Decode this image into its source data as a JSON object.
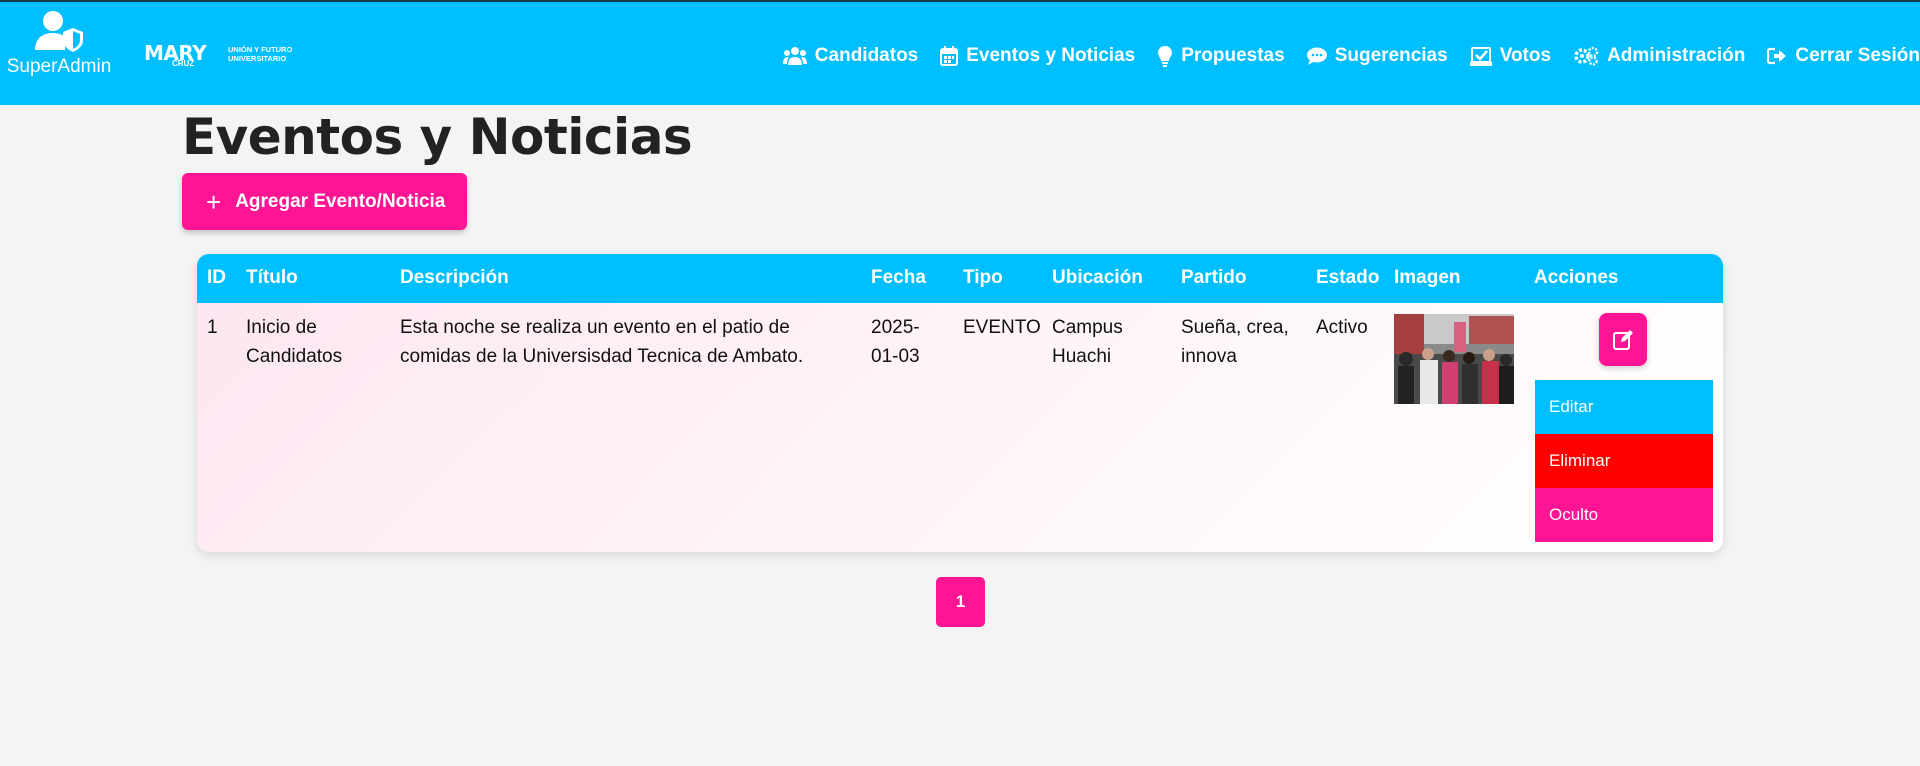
{
  "brand": {
    "label": "SuperAdmin"
  },
  "logo": {
    "name": "MARY",
    "sub": "CRUZ",
    "tagline": "UNIÓN Y FUTURO UNIVERSITARIO"
  },
  "nav": {
    "items": [
      {
        "label": "Candidatos",
        "icon": "users-icon"
      },
      {
        "label": "Eventos y Noticias",
        "icon": "calendar-icon"
      },
      {
        "label": "Propuestas",
        "icon": "lightbulb-icon"
      },
      {
        "label": "Sugerencias",
        "icon": "comment-icon"
      },
      {
        "label": "Votos",
        "icon": "vote-icon"
      },
      {
        "label": "Administración",
        "icon": "gears-icon"
      },
      {
        "label": "Cerrar Sesión",
        "icon": "logout-icon"
      }
    ]
  },
  "page": {
    "title": "Eventos y Noticias",
    "add_label": "Agregar Evento/Noticia"
  },
  "table": {
    "columns": [
      "ID",
      "Título",
      "Descripción",
      "Fecha",
      "Tipo",
      "Ubicación",
      "Partido",
      "Estado",
      "Imagen",
      "Acciones"
    ],
    "rows": [
      {
        "id": "1",
        "titulo_lines": [
          "Inicio de",
          "Candidatos"
        ],
        "descripcion_lines": [
          "Esta noche se realiza un evento en el patio de",
          "comidas de la Universisdad Tecnica de Ambato."
        ],
        "fecha_lines": [
          "2025-",
          "01-03"
        ],
        "tipo": "EVENTO",
        "ubicacion_lines": [
          "Campus",
          "Huachi"
        ],
        "partido_lines": [
          "Sueña, crea,",
          "innova"
        ],
        "estado": "Activo"
      }
    ]
  },
  "actions_menu": {
    "items": [
      {
        "label": "Editar",
        "color": "#00bfff"
      },
      {
        "label": "Eliminar",
        "color": "#ff0000"
      },
      {
        "label": "Oculto",
        "color": "#ff1493"
      }
    ]
  },
  "pagination": {
    "current": "1"
  },
  "colors": {
    "primary": "#00bfff",
    "accent": "#ff1493",
    "danger": "#ff0000",
    "background": "#f4f4f4"
  }
}
